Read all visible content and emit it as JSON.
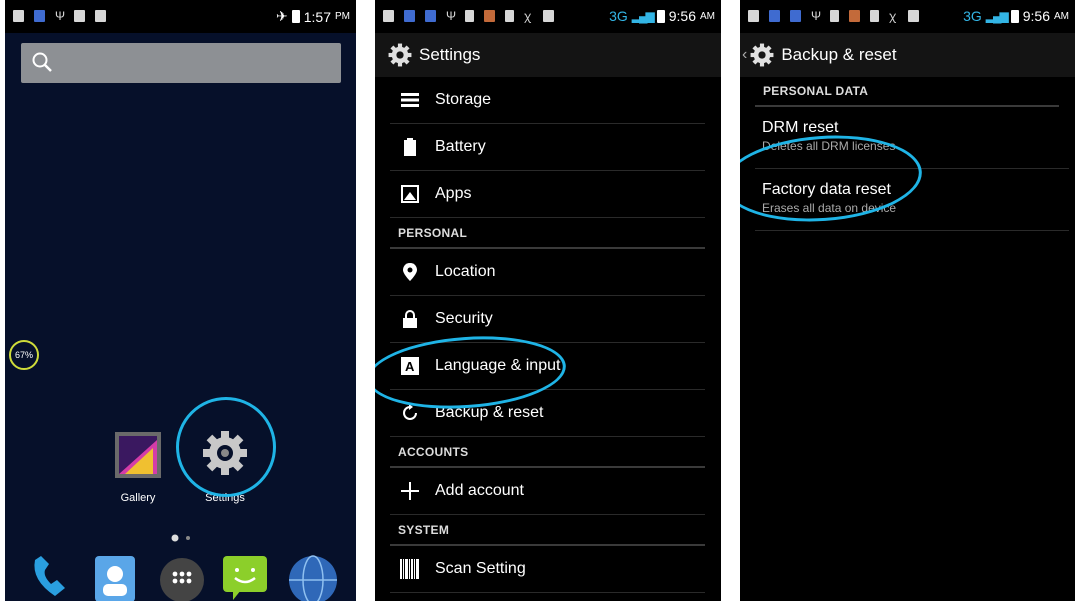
{
  "panel_home": {
    "status_time": "1:57",
    "status_ampm": "PM",
    "battery_widget": "67%",
    "apps": [
      "Gallery",
      "Settings"
    ]
  },
  "panel_settings": {
    "status_network": "3G",
    "status_time": "9:56",
    "status_ampm": "AM",
    "title": "Settings",
    "items_device": [
      "Storage",
      "Battery",
      "Apps"
    ],
    "cat_personal": "PERSONAL",
    "items_personal": [
      "Location",
      "Security",
      "Language & input",
      "Backup & reset"
    ],
    "cat_accounts": "ACCOUNTS",
    "add_account": "Add account",
    "cat_system": "SYSTEM",
    "scan_setting": "Scan Setting"
  },
  "panel_backup": {
    "status_network": "3G",
    "status_time": "9:56",
    "status_ampm": "AM",
    "title": "Backup & reset",
    "cat_personal_data": "PERSONAL DATA",
    "drm_title": "DRM reset",
    "drm_sub": "Deletes all DRM licenses",
    "factory_title": "Factory data reset",
    "factory_sub": "Erases all data on device"
  },
  "colors": {
    "highlight": "#1fb4e6",
    "accent": "#33b5e5"
  }
}
